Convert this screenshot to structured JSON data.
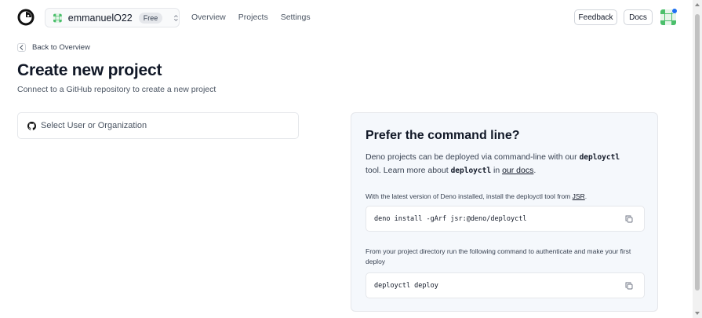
{
  "header": {
    "org_name": "emmanuelO22",
    "plan_badge": "Free",
    "nav": [
      "Overview",
      "Projects",
      "Settings"
    ],
    "feedback_label": "Feedback",
    "docs_label": "Docs"
  },
  "page": {
    "back_label": "Back to Overview",
    "title": "Create new project",
    "subtitle": "Connect to a GitHub repository to create a new project",
    "select_placeholder": "Select User or Organization"
  },
  "cli": {
    "title": "Prefer the command line?",
    "desc_part1": "Deno projects can be deployed via command-line with our",
    "tool_name": "deployctl",
    "desc_part2": "tool. Learn more about",
    "desc_part3": "in",
    "docs_link": "our docs",
    "period": ".",
    "step1_text": "With the latest version of Deno installed, install the deployctl tool from",
    "jsr_link": "JSR",
    "step1_command": "deno install -gArf jsr:@deno/deployctl",
    "step2_text": "From your project directory run the following command to authenticate and make your first deploy",
    "step2_command": "deployctl deploy"
  },
  "icons": {
    "logo": "deno-logo-icon",
    "org_avatar": "org-avatar-icon",
    "chevrons": "chevron-up-down-icon",
    "back": "chevron-left-icon",
    "github": "github-icon",
    "copy": "copy-icon"
  },
  "colors": {
    "avatar_green": "#4bbf6b",
    "notification": "#1d6ff2",
    "card_bg": "#f5f8fc"
  }
}
